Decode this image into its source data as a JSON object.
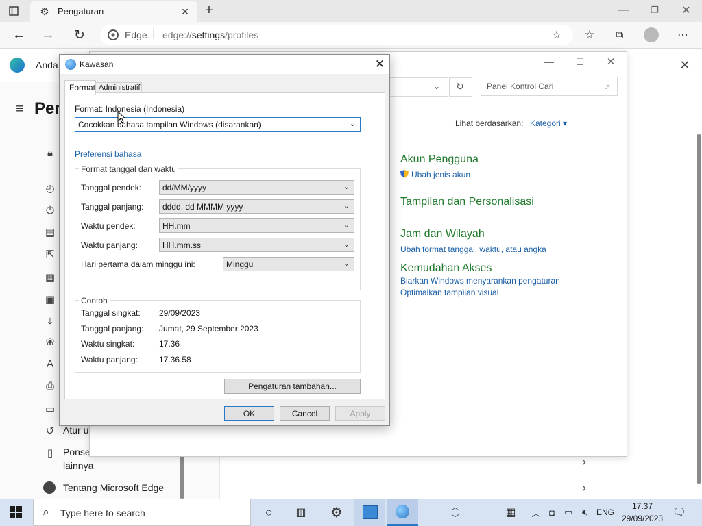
{
  "browser": {
    "tab_title": "Pengaturan",
    "brand": "Edge",
    "address_prefix": "edge://",
    "address_bold": "settings",
    "address_rest": "/profiles"
  },
  "settings": {
    "header_text": "Anda",
    "page_title": "Pen",
    "partial_items": [
      "Atur u",
      "Ponse",
      "lainnya"
    ],
    "about_label": "Tentang Microsoft Edge"
  },
  "control_panel": {
    "search_placeholder": "Panel Kontrol Cari",
    "view_by_label": "Lihat berdasarkan:",
    "view_by_value": "Kategori",
    "categories": [
      {
        "heading": "Akun Pengguna",
        "links": [
          "Ubah jenis akun"
        ]
      },
      {
        "heading": "Tampilan dan Personalisasi",
        "links": []
      },
      {
        "heading": "Jam dan Wilayah",
        "links": [
          "Ubah format tanggal, waktu, atau angka"
        ]
      },
      {
        "heading": "Kemudahan Akses",
        "links": [
          "Biarkan Windows menyarankan pengaturan",
          "Optimalkan tampilan visual"
        ]
      }
    ]
  },
  "dialog": {
    "title": "Kawasan",
    "tabs": [
      "Format",
      "Administratif"
    ],
    "format_label": "Format: Indonesia (Indonesia)",
    "format_select": "Cocokkan bahasa tampilan Windows (disarankan)",
    "language_pref_link": "Preferensi bahasa",
    "datetime_group": "Format tanggal dan waktu",
    "rows": [
      {
        "label": "Tanggal pendek:",
        "value": "dd/MM/yyyy"
      },
      {
        "label": "Tanggal panjang:",
        "value": "dddd, dd MMMM yyyy"
      },
      {
        "label": "Waktu pendek:",
        "value": "HH.mm"
      },
      {
        "label": "Waktu panjang:",
        "value": "HH.mm.ss"
      }
    ],
    "first_day_label": "Hari pertama dalam minggu ini:",
    "first_day_value": "Minggu",
    "examples_group": "Contoh",
    "examples": [
      {
        "label": "Tanggal singkat:",
        "value": "29/09/2023"
      },
      {
        "label": "Tanggal panjang:",
        "value": "Jumat, 29 September 2023"
      },
      {
        "label": "Waktu singkat:",
        "value": "17.36"
      },
      {
        "label": "Waktu panjang:",
        "value": "17.36.58"
      }
    ],
    "additional_button": "Pengaturan tambahan...",
    "ok": "OK",
    "cancel": "Cancel",
    "apply": "Apply"
  },
  "taskbar": {
    "search_placeholder": "Type here to search",
    "language": "ENG",
    "time": "17.37",
    "date": "29/09/2023"
  },
  "colors": {
    "link": "#1a5fa8",
    "category_heading": "#1f7a2b",
    "taskbar": "#d7e3f2"
  }
}
